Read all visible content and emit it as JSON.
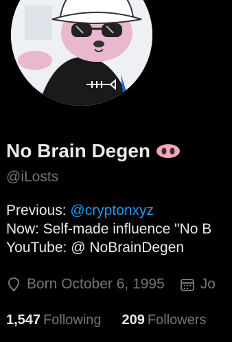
{
  "profile": {
    "display_name": "No Brain Degen",
    "badge_icon": "pig-nose-icon",
    "handle": "@iLosts"
  },
  "bio": {
    "line1_prefix": "Previous: ",
    "line1_link": "@cryptonxyz",
    "line2": "Now: Self-made influence \"No B",
    "line3": "YouTube: @ NoBrainDegen"
  },
  "meta": {
    "born_icon": "location-pin-icon",
    "born": "Born October 6, 1995",
    "joined_icon": "calendar-icon",
    "joined": "Jo"
  },
  "stats": {
    "following_count": "1,547",
    "following_label": "Following",
    "followers_count": "209",
    "followers_label": "Followers"
  },
  "colors": {
    "background": "#000000",
    "text": "#e7e9ea",
    "muted": "#71767b",
    "link": "#1d9bf0",
    "badge": "#f4a7b9"
  }
}
